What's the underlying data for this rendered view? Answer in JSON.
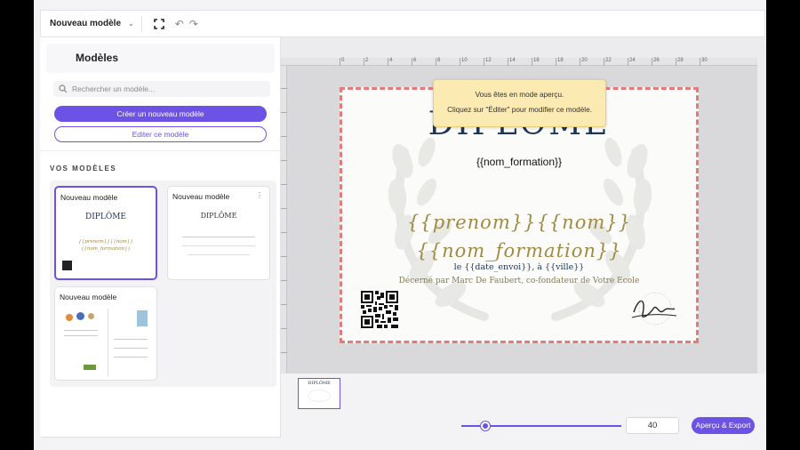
{
  "toolbar": {
    "doc_title": "Nouveau modèle"
  },
  "sidebar": {
    "title": "Modèles",
    "search_placeholder": "Rechercher un modèle...",
    "create_label": "Créer un nouveau modèle",
    "edit_label": "Editer ce modèle",
    "section_label": "VOS MODÈLES",
    "cards": [
      {
        "name": "Nouveau modèle",
        "selected": true
      },
      {
        "name": "Nouveau modèle",
        "selected": false
      },
      {
        "name": "Nouveau modèle",
        "selected": false
      }
    ]
  },
  "ruler": {
    "ticks": [
      "0",
      "2",
      "4",
      "6",
      "8",
      "10",
      "12",
      "14",
      "16",
      "18",
      "20",
      "22",
      "24",
      "26",
      "28",
      "30"
    ]
  },
  "certificate": {
    "title": "DIPLÔME",
    "formation": "{{nom_formation}}",
    "line_prenom_nom": "{{prenom}}{{nom}}",
    "line_formation": "{{nom_formation}}",
    "date_line": "le {{date_envoi}}, à {{ville}}",
    "awarded_by": "Décerné par Marc De Faubert, co-fondateur de Votre Ecole"
  },
  "tooltip": {
    "line1": "Vous êtes en mode aperçu.",
    "line2": "Cliquez sur \"Éditer\" pour modifier ce modèle."
  },
  "bottom": {
    "zoom_value": "40",
    "zoom_level": 0.15,
    "export_label": "Aperçu & Export"
  },
  "colors": {
    "accent": "#6d52e6",
    "certificate_border": "#e27b7b",
    "tooltip_bg": "#fbeab1",
    "script_gold": "#a08a43",
    "title_navy": "#1d3557"
  }
}
